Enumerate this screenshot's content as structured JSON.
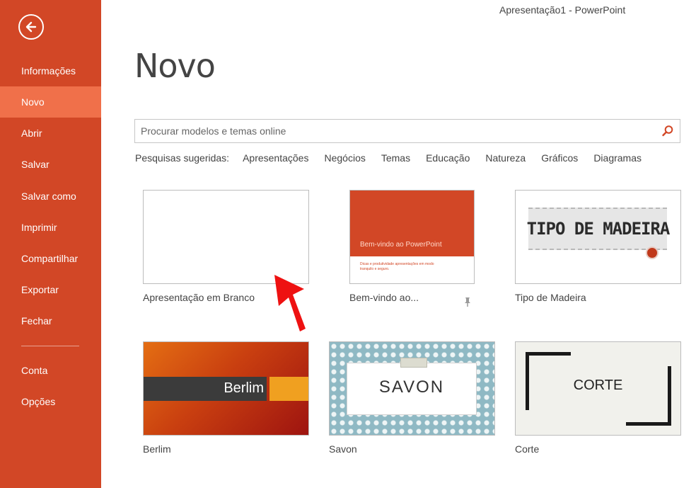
{
  "window": {
    "title": "Apresentação1 - PowerPoint"
  },
  "sidebar": {
    "back_icon": "back-arrow-icon",
    "items": [
      {
        "label": "Informações"
      },
      {
        "label": "Novo",
        "active": true
      },
      {
        "label": "Abrir"
      },
      {
        "label": "Salvar"
      },
      {
        "label": "Salvar como"
      },
      {
        "label": "Imprimir"
      },
      {
        "label": "Compartilhar"
      },
      {
        "label": "Exportar"
      },
      {
        "label": "Fechar"
      },
      {
        "label": "Conta"
      },
      {
        "label": "Opções"
      }
    ]
  },
  "main": {
    "title": "Novo",
    "search": {
      "placeholder": "Procurar modelos e temas online",
      "icon": "search-icon"
    },
    "suggested": {
      "label": "Pesquisas sugeridas:",
      "links": [
        "Apresentações",
        "Negócios",
        "Temas",
        "Educação",
        "Natureza",
        "Gráficos",
        "Diagramas"
      ]
    },
    "templates": [
      {
        "label": "Apresentação em Branco"
      },
      {
        "label": "Bem-vindo ao...",
        "thumb_title": "Bem-vindo ao PowerPoint",
        "thumb_subtitle_1": "Dicas e produtividade apresentações em modo",
        "thumb_subtitle_2": "tranquilo e seguro."
      },
      {
        "label": "Tipo de Madeira",
        "thumb_title": "TIPO DE MADEIRA"
      },
      {
        "label": "Berlim",
        "thumb_title": "Berlim"
      },
      {
        "label": "Savon",
        "thumb_title": "SAVON"
      },
      {
        "label": "Corte",
        "thumb_title": "CORTE"
      }
    ]
  },
  "colors": {
    "sidebar": "#d24726",
    "sidebar_active": "#f0704a",
    "accent": "#d24726",
    "annotation_arrow": "#ee1111"
  }
}
